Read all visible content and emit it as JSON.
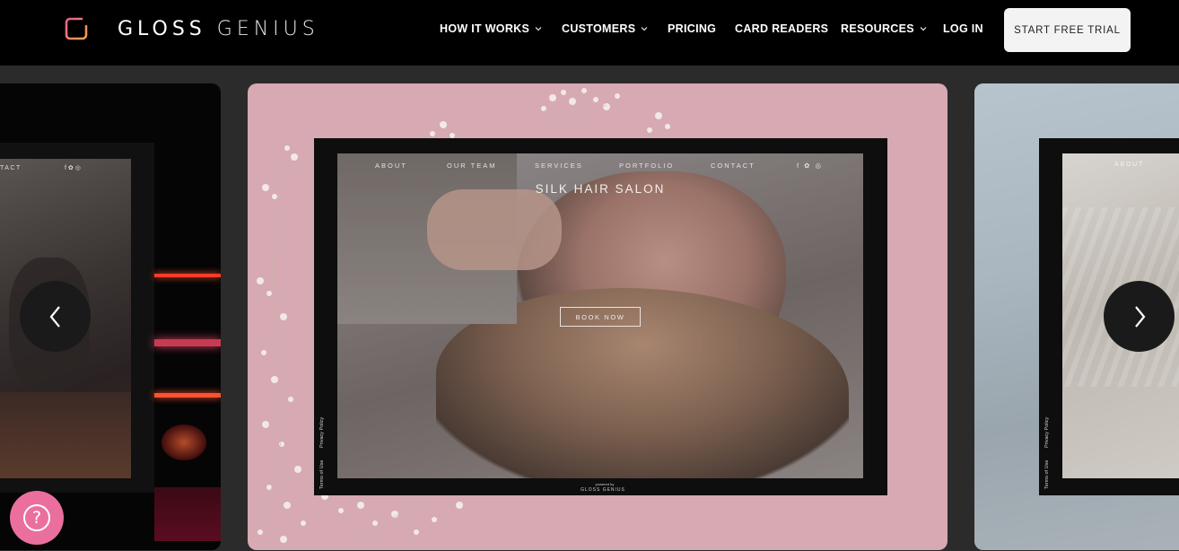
{
  "header": {
    "logo_text_bold": "GLOSS",
    "logo_text_light": "GENIUS",
    "nav": [
      {
        "label": "HOW IT WORKS",
        "dropdown": true
      },
      {
        "label": "CUSTOMERS",
        "dropdown": true
      },
      {
        "label": "PRICING",
        "dropdown": false
      },
      {
        "label": "CARD READERS",
        "dropdown": false
      },
      {
        "label": "RESOURCES",
        "dropdown": true
      },
      {
        "label": "LOG IN",
        "dropdown": false
      }
    ],
    "cta_label": "START FREE TRIAL"
  },
  "carousel": {
    "left_card": {
      "nav_partial": "TACT"
    },
    "center_card": {
      "nav": [
        "ABOUT",
        "OUR TEAM",
        "SERVICES",
        "PORTFOLIO",
        "CONTACT"
      ],
      "site_title": "SILK HAIR SALON",
      "book_label": "BOOK NOW",
      "legal_terms": "Terms of Use",
      "legal_privacy": "Privacy Policy",
      "powered_by": "powered by",
      "powered_logo": "GLOSS GENIUS"
    },
    "right_card": {
      "nav": [
        "ABOUT"
      ],
      "legal_terms": "Terms of Use",
      "legal_privacy": "Privacy Policy"
    }
  },
  "colors": {
    "accent": "#ea6f9f",
    "header_bg": "#000000",
    "center_card_bg": "#d7a9b2",
    "page_bg": "#2b2b2b"
  },
  "icons": {
    "prev": "chevron-left-icon",
    "next": "chevron-right-icon",
    "help": "question-icon"
  }
}
